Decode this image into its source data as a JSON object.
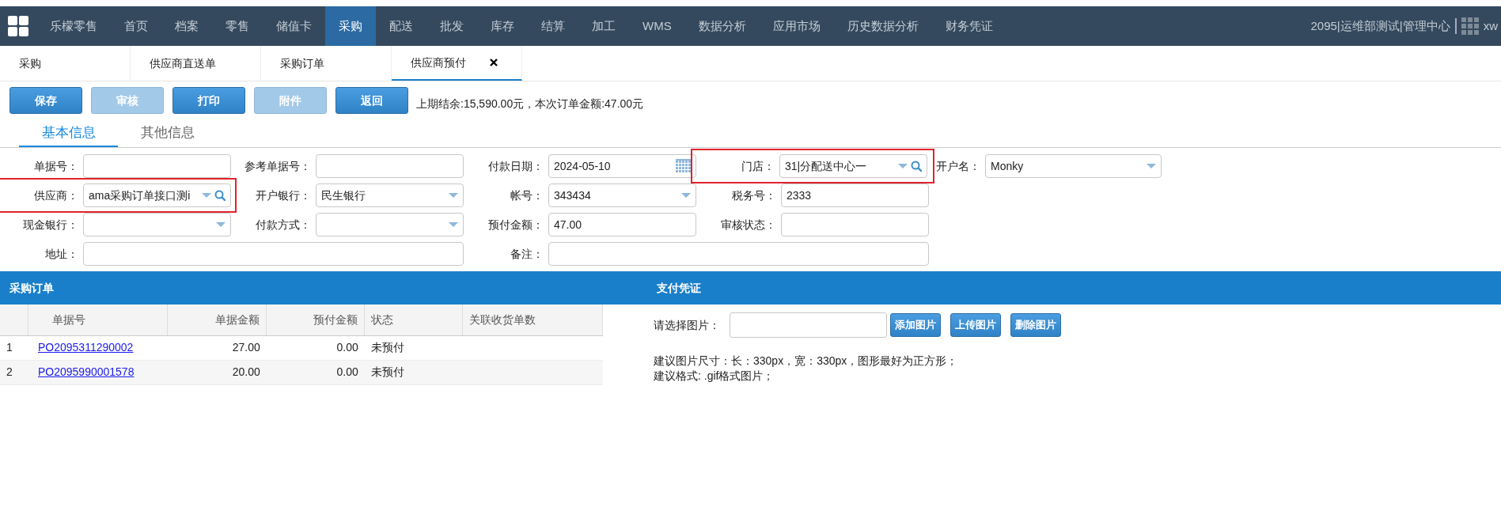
{
  "navbar": {
    "brand": "乐檬零售",
    "items": [
      {
        "label": "首页",
        "selected": false
      },
      {
        "label": "档案",
        "selected": false
      },
      {
        "label": "零售",
        "selected": false
      },
      {
        "label": "储值卡",
        "selected": false
      },
      {
        "label": "采购",
        "selected": true
      },
      {
        "label": "配送",
        "selected": false
      },
      {
        "label": "批发",
        "selected": false
      },
      {
        "label": "库存",
        "selected": false
      },
      {
        "label": "结算",
        "selected": false
      },
      {
        "label": "加工",
        "selected": false
      },
      {
        "label": "WMS",
        "selected": false
      },
      {
        "label": "数据分析",
        "selected": false
      },
      {
        "label": "应用市场",
        "selected": false
      },
      {
        "label": "历史数据分析",
        "selected": false
      },
      {
        "label": "财务凭证",
        "selected": false
      }
    ],
    "org": "2095|运维部测试|管理中心",
    "user": "xw"
  },
  "page_tabs": [
    {
      "label": "采购",
      "selected": false,
      "closable": false
    },
    {
      "label": "供应商直送单",
      "selected": false,
      "closable": false
    },
    {
      "label": "采购订单",
      "selected": false,
      "closable": false
    },
    {
      "label": "供应商预付",
      "selected": true,
      "closable": true
    }
  ],
  "toolbar": {
    "buttons": [
      {
        "label": "保存",
        "disabled": false
      },
      {
        "label": "审核",
        "disabled": true
      },
      {
        "label": "打印",
        "disabled": false
      },
      {
        "label": "附件",
        "disabled": true
      },
      {
        "label": "返回",
        "disabled": false
      }
    ],
    "summary": "上期结余:15,590.00元，本次订单金额:47.00元"
  },
  "info_tabs": [
    {
      "label": "基本信息",
      "selected": true
    },
    {
      "label": "其他信息",
      "selected": false
    }
  ],
  "form": {
    "rows": [
      [
        {
          "label": "单据号：",
          "kind": "text",
          "highlighted": false
        },
        {
          "label": "参考单据号：",
          "kind": "text",
          "highlighted": false
        },
        {
          "label": "付款日期：",
          "kind": "date",
          "value": "2024-05-10",
          "highlighted": false
        },
        {
          "label": "门店：",
          "kind": "search-select",
          "value": "31|分配送中心一",
          "highlighted": true
        },
        {
          "label": "开户名：",
          "kind": "select",
          "value": "Monky",
          "highlighted": false
        }
      ],
      [
        {
          "label": "供应商：",
          "kind": "search-select",
          "value": "ama采购订单接口测i",
          "highlighted": true
        },
        {
          "label": "开户银行：",
          "kind": "select",
          "value": "民生银行",
          "highlighted": false
        },
        {
          "label": "帐号：",
          "kind": "select",
          "value": "343434",
          "highlighted": false
        },
        {
          "label": "税务号：",
          "kind": "text",
          "value": "2333",
          "highlighted": false
        }
      ],
      [
        {
          "label": "现金银行：",
          "kind": "select",
          "highlighted": false
        },
        {
          "label": "付款方式：",
          "kind": "select",
          "highlighted": false
        },
        {
          "label": "预付金额：",
          "kind": "text",
          "value": "47.00",
          "highlighted": false
        },
        {
          "label": "审核状态：",
          "kind": "text",
          "highlighted": false
        }
      ],
      [
        {
          "label": "地址：",
          "kind": "wide",
          "highlighted": false
        },
        "",
        {
          "label": "备注：",
          "kind": "wide",
          "highlighted": false
        }
      ]
    ]
  },
  "orders": {
    "title": "采购订单",
    "columns": [
      "单据号",
      "单据金额",
      "预付金额",
      "状态",
      "关联收货单数"
    ],
    "rows": [
      {
        "index": "1",
        "number": "PO2095311290002",
        "amount": "27.00",
        "prepaid": "0.00",
        "status": "未预付"
      },
      {
        "index": "2",
        "number": "PO2095990001578",
        "amount": "20.00",
        "prepaid": "0.00",
        "status": "未预付"
      }
    ]
  },
  "voucher": {
    "title": "支付凭证",
    "label": "请选择图片：",
    "buttons": [
      "添加图片",
      "上传图片",
      "删除图片"
    ],
    "notes": [
      "建议图片尺寸：长：330px，宽：330px，图形最好为正方形；",
      "建议格式: .gif格式图片；"
    ]
  }
}
